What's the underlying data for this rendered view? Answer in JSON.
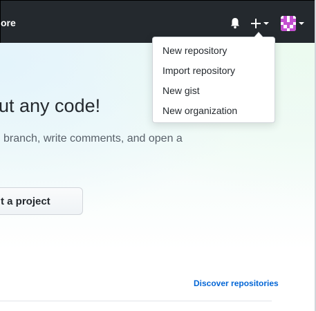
{
  "header": {
    "nav_partial": "ore",
    "icons": [
      "bell-icon",
      "plus-icon",
      "avatar"
    ]
  },
  "hero": {
    "headline": "ut any code!",
    "subtext": "branch, write comments, and open a",
    "button_label": "t a project"
  },
  "discover_link": "Discover repositories",
  "create_menu": {
    "items": [
      {
        "label": "New repository"
      },
      {
        "label": "Import repository"
      },
      {
        "label": "New gist"
      },
      {
        "label": "New organization"
      }
    ]
  },
  "colors": {
    "header_bg": "#24292e",
    "link": "#0366d6",
    "avatar": "#c44fd1"
  }
}
